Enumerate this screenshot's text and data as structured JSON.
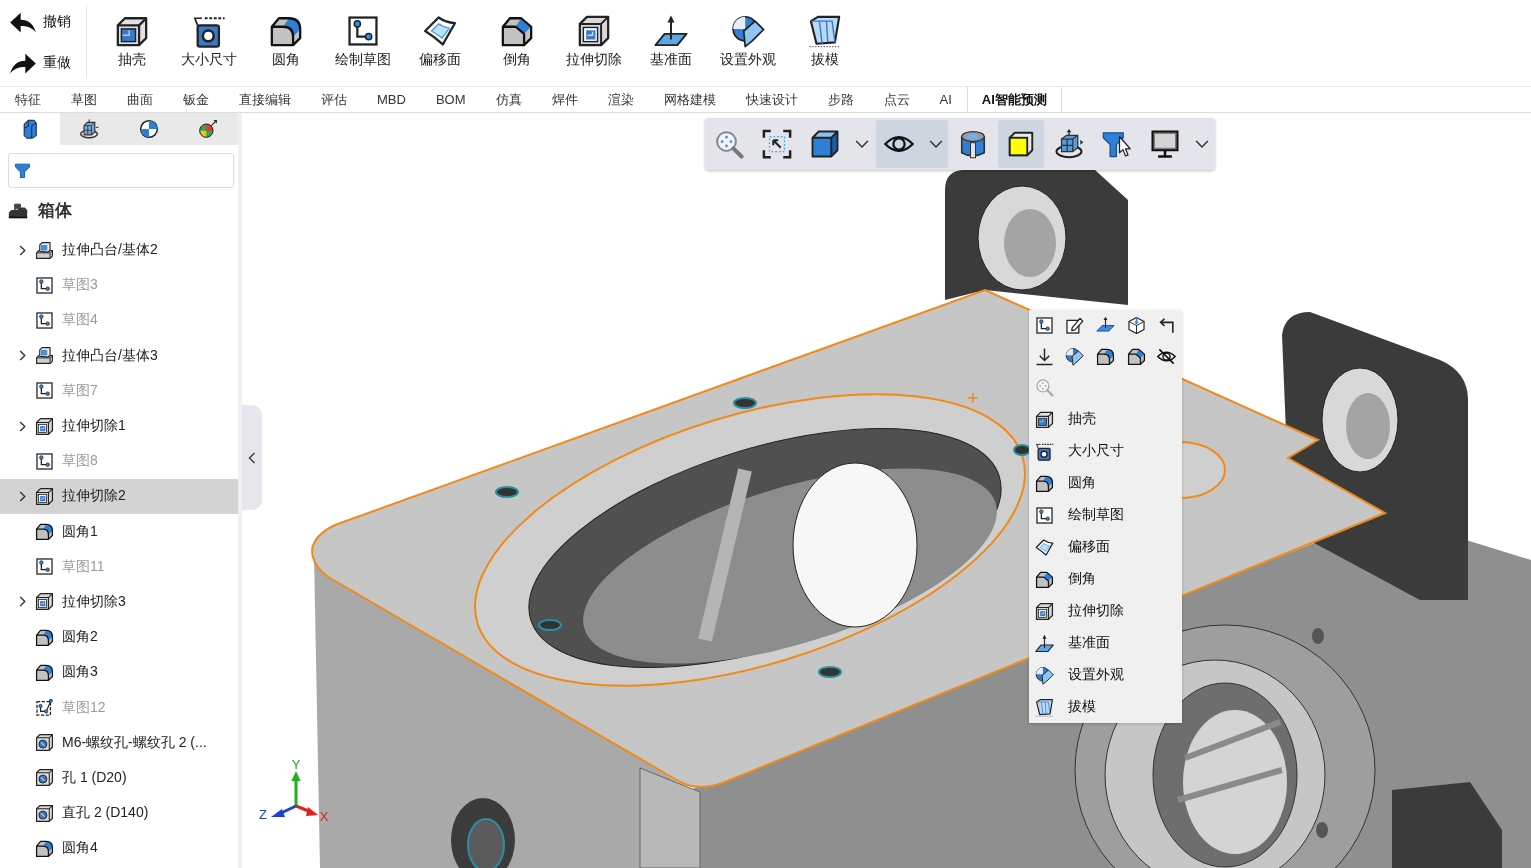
{
  "ribbon": {
    "history": [
      {
        "kind": "undo",
        "label": "撤销"
      },
      {
        "kind": "redo",
        "label": "重做"
      }
    ],
    "tools": [
      {
        "kind": "shell",
        "label": "抽壳"
      },
      {
        "kind": "size",
        "label": "大小尺寸"
      },
      {
        "kind": "fillet",
        "label": "圆角"
      },
      {
        "kind": "sketch",
        "label": "绘制草图"
      },
      {
        "kind": "offset_surface",
        "label": "偏移面"
      },
      {
        "kind": "chamfer",
        "label": "倒角"
      },
      {
        "kind": "extrude_cut",
        "label": "拉伸切除"
      },
      {
        "kind": "plane",
        "label": "基准面"
      },
      {
        "kind": "appearance",
        "label": "设置外观"
      },
      {
        "kind": "draft",
        "label": "拔模"
      }
    ]
  },
  "tabs": [
    {
      "label": "特征",
      "selected": false
    },
    {
      "label": "草图",
      "selected": false
    },
    {
      "label": "曲面",
      "selected": false
    },
    {
      "label": "钣金",
      "selected": false
    },
    {
      "label": "直接编辑",
      "selected": false
    },
    {
      "label": "评估",
      "selected": false
    },
    {
      "label": "MBD",
      "selected": false
    },
    {
      "label": "BOM",
      "selected": false
    },
    {
      "label": "仿真",
      "selected": false
    },
    {
      "label": "焊件",
      "selected": false
    },
    {
      "label": "渲染",
      "selected": false
    },
    {
      "label": "网格建模",
      "selected": false
    },
    {
      "label": "快速设计",
      "selected": false
    },
    {
      "label": "步路",
      "selected": false
    },
    {
      "label": "点云",
      "selected": false
    },
    {
      "label": "AI",
      "selected": false
    },
    {
      "label": "AI智能预测",
      "selected": true
    }
  ],
  "sidebar": {
    "panel_tabs": [
      {
        "kind": "feature_tree",
        "selected": true
      },
      {
        "kind": "property",
        "selected": false
      },
      {
        "kind": "appearance_panel",
        "selected": false
      },
      {
        "kind": "display_panel",
        "selected": false
      }
    ],
    "tree": {
      "root": {
        "kind": "part",
        "label": "箱体"
      },
      "items": [
        {
          "kind": "boss",
          "label": "拉伸凸台/基体2",
          "expandable": true,
          "dimmed": false,
          "selected": false
        },
        {
          "kind": "sketch",
          "label": "草图3",
          "expandable": false,
          "dimmed": true,
          "selected": false
        },
        {
          "kind": "sketch",
          "label": "草图4",
          "expandable": false,
          "dimmed": true,
          "selected": false
        },
        {
          "kind": "boss",
          "label": "拉伸凸台/基体3",
          "expandable": true,
          "dimmed": false,
          "selected": false
        },
        {
          "kind": "sketch",
          "label": "草图7",
          "expandable": false,
          "dimmed": true,
          "selected": false
        },
        {
          "kind": "extrude_cut",
          "label": "拉伸切除1",
          "expandable": true,
          "dimmed": false,
          "selected": false
        },
        {
          "kind": "sketch",
          "label": "草图8",
          "expandable": false,
          "dimmed": true,
          "selected": false
        },
        {
          "kind": "extrude_cut",
          "label": "拉伸切除2",
          "expandable": true,
          "dimmed": false,
          "selected": true
        },
        {
          "kind": "fillet",
          "label": "圆角1",
          "expandable": false,
          "dimmed": false,
          "selected": false
        },
        {
          "kind": "sketch",
          "label": "草图11",
          "expandable": false,
          "dimmed": true,
          "selected": false
        },
        {
          "kind": "extrude_cut",
          "label": "拉伸切除3",
          "expandable": true,
          "dimmed": false,
          "selected": false
        },
        {
          "kind": "fillet",
          "label": "圆角2",
          "expandable": false,
          "dimmed": false,
          "selected": false
        },
        {
          "kind": "fillet",
          "label": "圆角3",
          "expandable": false,
          "dimmed": false,
          "selected": false
        },
        {
          "kind": "sketch3d",
          "label": "草图12",
          "expandable": false,
          "dimmed": true,
          "selected": false
        },
        {
          "kind": "hole",
          "label": "M6-螺纹孔-螺纹孔 2 (...",
          "expandable": false,
          "dimmed": false,
          "selected": false
        },
        {
          "kind": "hole",
          "label": "孔 1 (D20)",
          "expandable": false,
          "dimmed": false,
          "selected": false
        },
        {
          "kind": "hole",
          "label": "直孔 2 (D140)",
          "expandable": false,
          "dimmed": false,
          "selected": false
        },
        {
          "kind": "fillet",
          "label": "圆角4",
          "expandable": false,
          "dimmed": false,
          "selected": false
        }
      ]
    }
  },
  "view_toolbar": [
    {
      "kind": "zoom_fit",
      "selected": false,
      "dropdown": false
    },
    {
      "kind": "zoom_area",
      "selected": false,
      "dropdown": false
    },
    {
      "kind": "view_orientation",
      "selected": false,
      "dropdown": true
    },
    {
      "kind": "hide_show",
      "selected": true,
      "dropdown": true
    },
    {
      "kind": "section",
      "selected": false,
      "dropdown": false
    },
    {
      "kind": "edit_appearance",
      "selected": true,
      "dropdown": false
    },
    {
      "kind": "view_settings",
      "selected": false,
      "dropdown": false
    },
    {
      "kind": "selection_filter",
      "selected": false,
      "dropdown": false
    },
    {
      "kind": "display",
      "selected": false,
      "dropdown": true
    }
  ],
  "context_menu": {
    "icon_rows": [
      [
        {
          "kind": "sketch"
        },
        {
          "kind": "edit_sketch"
        },
        {
          "kind": "plane_flat"
        },
        {
          "kind": "normal_to"
        },
        {
          "kind": "rollback"
        }
      ],
      [
        {
          "kind": "insert"
        },
        {
          "kind": "appearance"
        },
        {
          "kind": "fillet"
        },
        {
          "kind": "chamfer"
        },
        {
          "kind": "hide"
        }
      ],
      [
        {
          "kind": "zoom_small"
        }
      ]
    ],
    "items": [
      {
        "kind": "shell",
        "label": "抽壳"
      },
      {
        "kind": "size",
        "label": "大小尺寸"
      },
      {
        "kind": "fillet",
        "label": "圆角"
      },
      {
        "kind": "sketch",
        "label": "绘制草图"
      },
      {
        "kind": "offset_surface",
        "label": "偏移面"
      },
      {
        "kind": "chamfer",
        "label": "倒角"
      },
      {
        "kind": "extrude_cut",
        "label": "拉伸切除"
      },
      {
        "kind": "plane",
        "label": "基准面"
      },
      {
        "kind": "appearance",
        "label": "设置外观"
      },
      {
        "kind": "draft",
        "label": "拔模"
      }
    ]
  },
  "viewport": {
    "axes": [
      {
        "kind": "y",
        "label": "Y",
        "color": "#1fb01f"
      },
      {
        "kind": "z",
        "label": "Z",
        "color": "#1f3fd0"
      },
      {
        "kind": "x",
        "label": "X",
        "color": "#e0201a"
      }
    ]
  }
}
